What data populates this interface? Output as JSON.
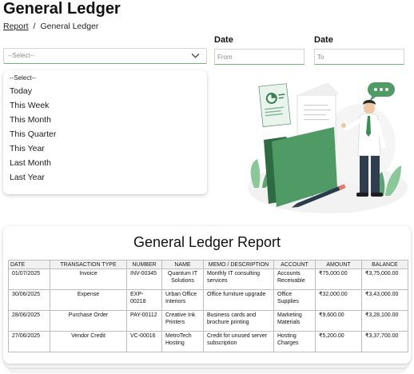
{
  "page": {
    "title": "General Ledger",
    "breadcrumb": {
      "link": "Report",
      "separator": "/",
      "current": "General Ledger"
    }
  },
  "filters": {
    "period_select": {
      "value": "--Select--",
      "icon": "chevron-down-icon"
    },
    "date_from": {
      "label": "Date",
      "placeholder": "From"
    },
    "date_to": {
      "label": "Date",
      "placeholder": "To"
    }
  },
  "dropdown": {
    "options": [
      "--Select--",
      "Today",
      "This Week",
      "This Month",
      "This Quarter",
      "This Year",
      "Last Month",
      "Last Year"
    ]
  },
  "illustration": {
    "icon": "ledger-illustration",
    "accent_color": "#4f9a65"
  },
  "report": {
    "title": "General Ledger Report",
    "columns": [
      "Date",
      "Transaction Type",
      "Number",
      "Name",
      "Memo / Description",
      "Account",
      "Amount",
      "Balance"
    ],
    "rows": [
      [
        "01/07/2025",
        "Invoice",
        "INV-00345",
        "Quantum IT Solutions",
        "Monthly IT consulting services",
        "Accounts Receivable",
        "₹75,000.00",
        "₹3,75,000.00"
      ],
      [
        "30/06/2025",
        "Expense",
        "EXP-00218",
        "Urban Office Interiors",
        "Office furniture upgrade",
        "Office Supplies",
        "₹32,000.00",
        "₹3,43,000.00"
      ],
      [
        "28/06/2025",
        "Purchase Order",
        "PAY-00112",
        "Creative Ink Printers",
        "Business cards and brochure printing",
        "Marketing Materials",
        "₹9,600.00",
        "₹3,28,100.00"
      ],
      [
        "27/06/2025",
        "Vendor Credit",
        "VC-00016",
        "MetroTech Hosting",
        "Credit for unused server subscription",
        "Hosting Charges",
        "₹5,200.00",
        "₹3,37,700.00"
      ]
    ]
  }
}
